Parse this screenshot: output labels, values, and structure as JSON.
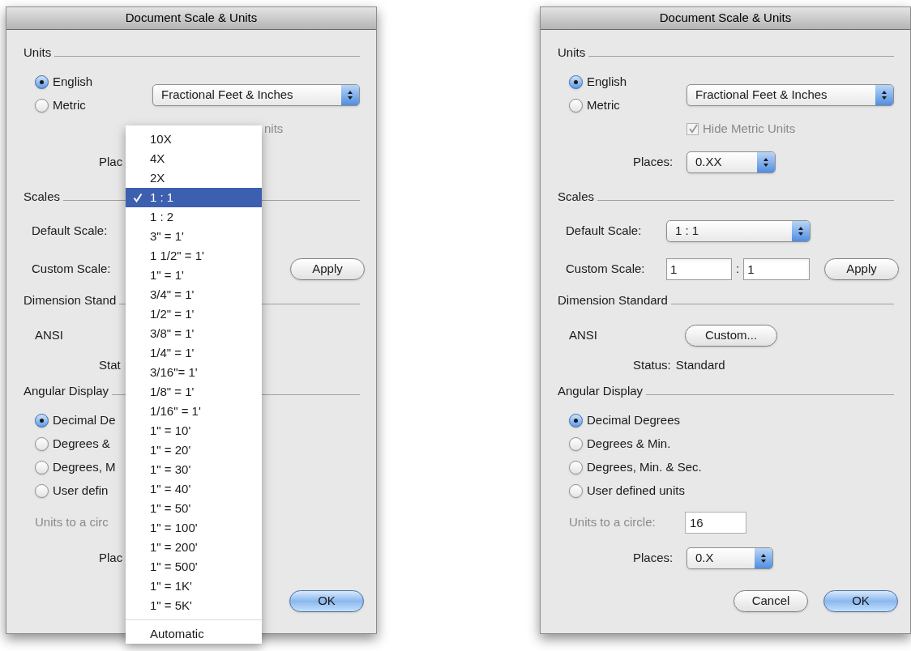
{
  "dialogs": [
    {
      "title": "Document Scale & Units",
      "units": {
        "heading": "Units",
        "options": [
          {
            "label": "English",
            "selected": true
          },
          {
            "label": "Metric",
            "selected": false
          }
        ],
        "format": "Fractional Feet & Inches",
        "hide_metric_fragment": "nits",
        "places_label": "Plac"
      },
      "scales": {
        "heading": "Scales",
        "default_label": "Default Scale:",
        "custom_label": "Custom Scale:",
        "apply": "Apply"
      },
      "dimension": {
        "heading": "Dimension Stand",
        "standard": "ANSI",
        "status_label": "Stat"
      },
      "angular": {
        "heading": "Angular Display",
        "options": [
          {
            "label": "Decimal De",
            "selected": true
          },
          {
            "label": "Degrees &",
            "selected": false
          },
          {
            "label": "Degrees, M",
            "selected": false
          },
          {
            "label": "User defin",
            "selected": false
          }
        ],
        "circle_label": "Units to a circ",
        "circle_disabled": true,
        "places_label": "Plac"
      },
      "buttons": [
        {
          "label": "OK",
          "default": true
        }
      ],
      "menu": {
        "items": [
          {
            "label": "10X",
            "selected": false
          },
          {
            "label": "4X",
            "selected": false
          },
          {
            "label": "2X",
            "selected": false
          },
          {
            "label": "1 : 1",
            "selected": true
          },
          {
            "label": "1 : 2",
            "selected": false
          },
          {
            "label": "3\" = 1'",
            "selected": false
          },
          {
            "label": "1 1/2\" = 1'",
            "selected": false
          },
          {
            "label": "1\" = 1'",
            "selected": false
          },
          {
            "label": "3/4\" = 1'",
            "selected": false
          },
          {
            "label": "1/2\" = 1'",
            "selected": false
          },
          {
            "label": "3/8\" = 1'",
            "selected": false
          },
          {
            "label": "1/4\" = 1'",
            "selected": false
          },
          {
            "label": "3/16\"= 1'",
            "selected": false
          },
          {
            "label": "1/8\" = 1'",
            "selected": false
          },
          {
            "label": "1/16\" = 1'",
            "selected": false
          },
          {
            "label": "1\" = 10'",
            "selected": false
          },
          {
            "label": "1\" = 20'",
            "selected": false
          },
          {
            "label": "1\" = 30'",
            "selected": false
          },
          {
            "label": "1\" = 40'",
            "selected": false
          },
          {
            "label": "1\" = 50'",
            "selected": false
          },
          {
            "label": "1\" = 100'",
            "selected": false
          },
          {
            "label": "1\" = 200'",
            "selected": false
          },
          {
            "label": "1\" = 500'",
            "selected": false
          },
          {
            "label": "1\" = 1K'",
            "selected": false
          },
          {
            "label": "1\" = 5K'",
            "selected": false
          }
        ],
        "footer": "Automatic"
      }
    },
    {
      "title": "Document Scale & Units",
      "units": {
        "heading": "Units",
        "options": [
          {
            "label": "English",
            "selected": true
          },
          {
            "label": "Metric",
            "selected": false
          }
        ],
        "format": "Fractional Feet & Inches",
        "hide_metric": {
          "label": "Hide Metric Units",
          "checked": true,
          "disabled": true
        },
        "places_label": "Places:",
        "places": "0.XX"
      },
      "scales": {
        "heading": "Scales",
        "default_label": "Default Scale:",
        "default_value": "1 : 1",
        "custom_label": "Custom Scale:",
        "custom_a": "1",
        "separator": ":",
        "custom_b": "1",
        "apply": "Apply"
      },
      "dimension": {
        "heading": "Dimension Standard",
        "standard": "ANSI",
        "custom_button": "Custom...",
        "status_label": "Status:",
        "status_value": "Standard"
      },
      "angular": {
        "heading": "Angular Display",
        "options": [
          {
            "label": "Decimal Degrees",
            "selected": true
          },
          {
            "label": "Degrees & Min.",
            "selected": false
          },
          {
            "label": "Degrees, Min. & Sec.",
            "selected": false
          },
          {
            "label": "User defined units",
            "selected": false
          }
        ],
        "circle_label": "Units to a circle:",
        "circle_disabled": true,
        "circle_value": "16",
        "places_label": "Places:",
        "places": "0.X"
      },
      "buttons": [
        {
          "label": "Cancel",
          "default": false
        },
        {
          "label": "OK",
          "default": true
        }
      ]
    }
  ]
}
